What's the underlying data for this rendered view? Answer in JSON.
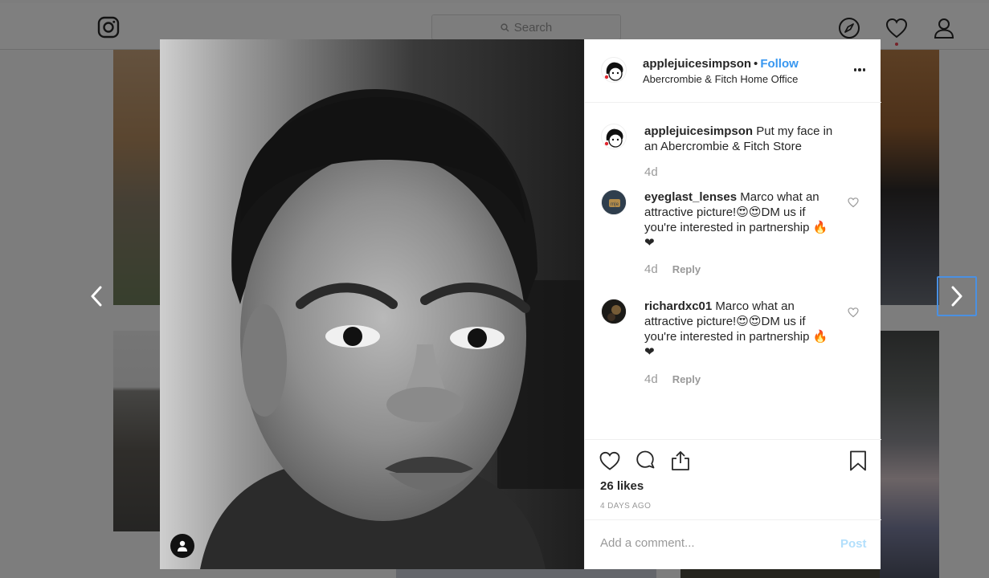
{
  "topbar": {
    "search_placeholder": "Search"
  },
  "post": {
    "username": "applejuicesimpson",
    "separator": "•",
    "follow_label": "Follow",
    "location": "Abercrombie & Fitch Home Office",
    "caption": {
      "username": "applejuicesimpson",
      "text": "Put my face in an Abercrombie & Fitch Store",
      "age": "4d"
    },
    "comments": [
      {
        "username": "eyeglast_lenses",
        "text": "Marco what an attractive picture!😍😍DM us if you're interested in partnership 🔥❤",
        "age": "4d",
        "reply_label": "Reply"
      },
      {
        "username": "richardxc01",
        "text": "Marco what an attractive picture!😍😍DM us if you're interested in partnership 🔥❤",
        "age": "4d",
        "reply_label": "Reply"
      }
    ],
    "likes": "26 likes",
    "date": "4 DAYS AGO",
    "comment_placeholder": "Add a comment...",
    "post_label": "Post"
  },
  "icons": {
    "logo": "instagram-logo-icon",
    "explore": "compass-icon",
    "activity": "heart-icon",
    "profile": "person-icon",
    "prev": "chevron-left-icon",
    "next": "chevron-right-icon",
    "more": "ellipsis-icon",
    "like": "heart-outline-icon",
    "comment": "speech-bubble-icon",
    "share": "share-icon",
    "save": "bookmark-icon",
    "user_tag": "user-tag-icon"
  },
  "colors": {
    "follow": "#3897f0",
    "post_disabled": "#b2dffc",
    "notification_dot": "#ed4956",
    "focus_outline": "#4a90e2"
  }
}
